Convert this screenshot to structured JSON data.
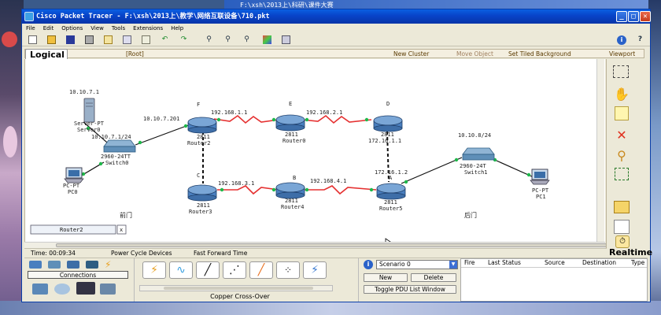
{
  "background_window": {
    "title": "F:\\xsh\\2013上\\科研\\课件大赛"
  },
  "window": {
    "title": "Cisco Packet Tracer - F:\\xsh\\2013上\\教学\\网络互联设备\\710.pkt",
    "controls": {
      "minimize": "_",
      "maximize": "□",
      "close": "✕"
    }
  },
  "menu": [
    "File",
    "Edit",
    "Options",
    "View",
    "Tools",
    "Extensions",
    "Help"
  ],
  "toolbar": {
    "icons": [
      "new-icon",
      "open-icon",
      "save-icon",
      "print-icon",
      "activity-wizard-icon",
      "copy-icon",
      "paste-icon",
      "undo-icon",
      "redo-icon",
      "zoom-in-icon",
      "zoom-reset-icon",
      "zoom-out-icon",
      "drawing-palette-icon",
      "custom-device-icon"
    ],
    "help_glyph": "i",
    "question_glyph": "?"
  },
  "workspace": {
    "tab_label": "Logical",
    "root": "[Root]",
    "new_cluster": "New Cluster",
    "move_object": "Move Object",
    "set_background": "Set Tiled Background",
    "viewport": "Viewport"
  },
  "topology": {
    "devices": [
      {
        "id": "server",
        "model": "Server-PT",
        "name": "Server0",
        "ip": "10.10.7.1"
      },
      {
        "id": "switch0",
        "model": "2960-24TT",
        "name": "Switch0",
        "ip": "10.10.7.1/24"
      },
      {
        "id": "pc0",
        "model": "PC-PT",
        "name": "PC0"
      },
      {
        "id": "router2",
        "model": "2811",
        "name": "Router2",
        "letter": "F",
        "ip": "10.10.7.201"
      },
      {
        "id": "router0",
        "model": "2811",
        "name": "Router0",
        "letter": "E"
      },
      {
        "id": "routerD",
        "model": "2811",
        "name": "172.16.1.1",
        "letter": "D"
      },
      {
        "id": "router3",
        "model": "2811",
        "name": "Router3",
        "letter": "C"
      },
      {
        "id": "router4",
        "model": "2811",
        "name": "Router4",
        "letter": "B"
      },
      {
        "id": "router5",
        "model": "2811",
        "name": "Router5",
        "letter": "A",
        "ip": "172.16.1.2"
      },
      {
        "id": "switch1",
        "model": "2960-24T",
        "name": "Switch1",
        "ip": "10.10.8/24"
      },
      {
        "id": "pc1",
        "model": "PC-PT",
        "name": "PC1"
      }
    ],
    "link_labels": [
      "192.168.1.1",
      "192.168.2.1",
      "192.168.3.1",
      "192.168.4.1"
    ],
    "area_left": "前门",
    "area_right": "后门",
    "tooltip": "Router2",
    "tooltip_close": "x"
  },
  "right_palette": [
    "select-icon",
    "move-layout-icon",
    "place-note-icon",
    "delete-icon",
    "inspect-icon",
    "resize-shape-icon",
    "add-simple-pdu-icon",
    "add-complex-pdu-icon"
  ],
  "realtime": {
    "label": "Realtime",
    "clock": "⏱"
  },
  "status": {
    "time_label": "Time: 00:09:34",
    "power_cycle": "Power Cycle Devices",
    "fast_forward": "Fast Forward Time"
  },
  "device_panel": {
    "category_label": "Connections",
    "cable_label": "Copper Cross-Over",
    "cable_glyphs": [
      "⚡",
      "∿",
      "╱",
      "⋰",
      "╱",
      "⁘",
      "⚡"
    ]
  },
  "scenario": {
    "info": "i",
    "selected": "Scenario 0",
    "new_btn": "New",
    "delete_btn": "Delete",
    "toggle_btn": "Toggle PDU List Window"
  },
  "pdu_table": {
    "columns": [
      "Fire",
      "Last Status",
      "Source",
      "Destination",
      "Type"
    ]
  },
  "colors": {
    "title_blue": "#0843c8",
    "serial_red": "#e53030",
    "link_green": "#1eb84a",
    "router_blue": "#4a7fbf"
  }
}
